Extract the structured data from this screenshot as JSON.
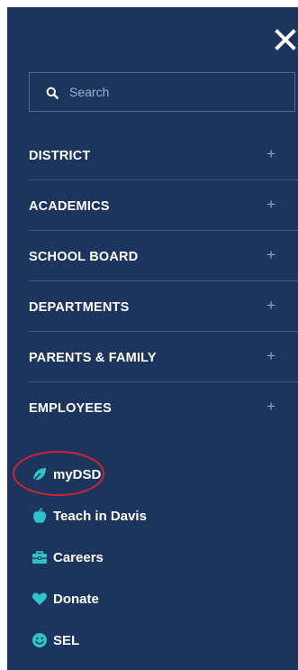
{
  "search": {
    "placeholder": "Search"
  },
  "nav": {
    "items": [
      {
        "label": "DISTRICT",
        "expand_symbol": "+"
      },
      {
        "label": "ACADEMICS",
        "expand_symbol": "+"
      },
      {
        "label": "SCHOOL BOARD",
        "expand_symbol": "+"
      },
      {
        "label": "DEPARTMENTS",
        "expand_symbol": "+"
      },
      {
        "label": "PARENTS & FAMILY",
        "expand_symbol": "+"
      },
      {
        "label": "EMPLOYEES",
        "expand_symbol": "+"
      }
    ]
  },
  "links": {
    "items": [
      {
        "label": "myDSD",
        "icon": "leaf-icon",
        "icon_color": "#2ec4c9"
      },
      {
        "label": "Teach in Davis",
        "icon": "apple-icon",
        "icon_color": "#2ec4c9"
      },
      {
        "label": "Careers",
        "icon": "briefcase-icon",
        "icon_color": "#2ec4c9"
      },
      {
        "label": "Donate",
        "icon": "heart-icon",
        "icon_color": "#2ec4c9"
      },
      {
        "label": "SEL",
        "icon": "smile-icon",
        "icon_color": "#2ec4c9"
      }
    ]
  },
  "colors": {
    "panel_background": "#1c355e",
    "divider": "#3c5680",
    "accent": "#2ec4c9",
    "highlight_ring": "#d2232a",
    "text": "#ffffff"
  }
}
